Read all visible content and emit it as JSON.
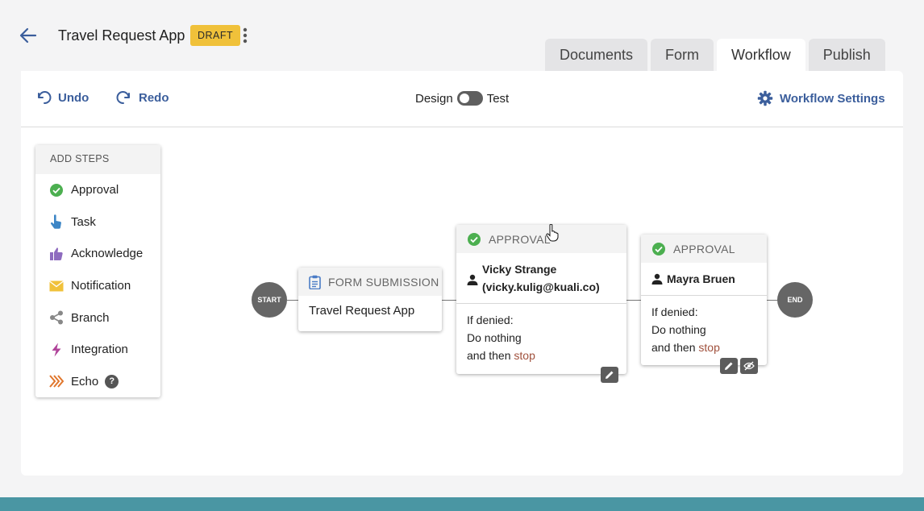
{
  "header": {
    "back_icon": "arrow-left-icon",
    "title": "Travel Request App",
    "badge": "DRAFT",
    "menu_icon": "kebab-vertical-icon"
  },
  "tabs": [
    {
      "label": "Documents",
      "active": false
    },
    {
      "label": "Form",
      "active": false
    },
    {
      "label": "Workflow",
      "active": true
    },
    {
      "label": "Publish",
      "active": false
    }
  ],
  "toolbar": {
    "undo_label": "Undo",
    "redo_label": "Redo",
    "toggle_left": "Design",
    "toggle_right": "Test",
    "settings_label": "Workflow Settings"
  },
  "add_steps": {
    "header": "ADD STEPS",
    "items": [
      {
        "label": "Approval",
        "icon": "check-circle-icon",
        "color": "#4caf50"
      },
      {
        "label": "Task",
        "icon": "pointing-hand-icon",
        "color": "#3d86c6"
      },
      {
        "label": "Acknowledge",
        "icon": "thumbs-up-icon",
        "color": "#8e6bbf"
      },
      {
        "label": "Notification",
        "icon": "envelope-icon",
        "color": "#f0c13a"
      },
      {
        "label": "Branch",
        "icon": "share-icon",
        "color": "#888888"
      },
      {
        "label": "Integration",
        "icon": "lightning-icon",
        "color": "#b0449a"
      },
      {
        "label": "Echo",
        "icon": "chevrons-right-icon",
        "color": "#e0762c"
      }
    ]
  },
  "workflow": {
    "start_label": "START",
    "end_label": "END",
    "form_node": {
      "header": "FORM SUBMISSION",
      "body": "Travel Request App"
    },
    "approval_1": {
      "header": "APPROVAL",
      "approver_name": "Vicky Strange",
      "approver_email": "(vicky.kulig@kuali.co)",
      "denied_line1": "If denied:",
      "denied_line2": "Do nothing",
      "denied_line3_prefix": "and then ",
      "denied_line3_action": "stop"
    },
    "approval_2": {
      "header": "APPROVAL",
      "approver_name": "Mayra Bruen",
      "denied_line1": "If denied:",
      "denied_line2": "Do nothing",
      "denied_line3_prefix": "and then ",
      "denied_line3_action": "stop"
    }
  },
  "colors": {
    "accent": "#3b5e9c",
    "draft_badge": "#f0c13a",
    "approval_check": "#4caf50",
    "stop_text": "#a0503c",
    "bottom_bar": "#4a96a3"
  }
}
